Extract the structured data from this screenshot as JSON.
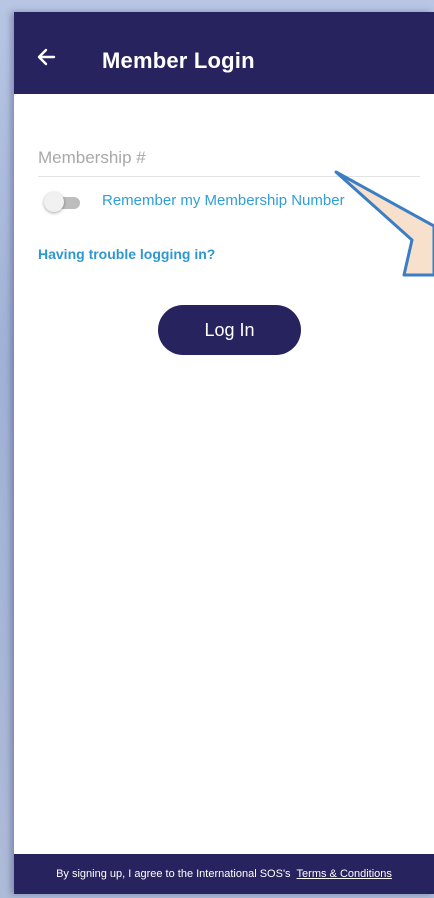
{
  "header": {
    "back_icon": "arrow-left-icon",
    "title": "Member Login"
  },
  "form": {
    "membership_placeholder": "Membership #",
    "membership_value": "",
    "remember_label": "Remember my Membership Number",
    "remember_toggle_on": false,
    "trouble_link": "Having trouble logging in?",
    "login_label": "Log In"
  },
  "footer": {
    "text": "By signing up, I agree to the International SOS's",
    "terms_link": "Terms & Conditions"
  },
  "colors": {
    "primary": "#27235e",
    "link": "#2f97d0",
    "callout_fill": "#f8e1cc",
    "callout_stroke": "#3a7ec4"
  }
}
